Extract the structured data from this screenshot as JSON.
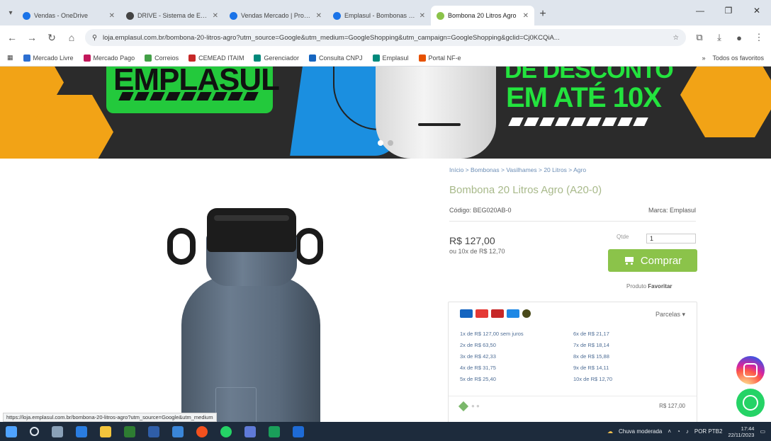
{
  "browser": {
    "tabs": [
      {
        "title": "Vendas - OneDrive",
        "color": "#1a73e8",
        "active": false
      },
      {
        "title": "DRIVE - Sistema de Emplasul",
        "color": "#444444",
        "active": false
      },
      {
        "title": "Vendas Mercado | Produtos",
        "color": "#1a73e8",
        "active": false
      },
      {
        "title": "Emplasul - Bombonas plas",
        "color": "#1a73e8",
        "active": false
      },
      {
        "title": "Bombona 20 Litros Agro",
        "color": "#8bc34a",
        "active": true
      }
    ],
    "new_tab": "+",
    "window_controls": [
      "—",
      "❐",
      "✕"
    ],
    "url": "loja.emplasul.com.br/bombona-20-litros-agro?utm_source=Google&utm_medium=GoogleShopping&utm_campaign=GoogleShopping&gclid=Cj0KCQiA...",
    "bookmarks": [
      {
        "label": "Mercado Livre",
        "color": "#2d6fd1"
      },
      {
        "label": "Mercado Pago",
        "color": "#c2185b"
      },
      {
        "label": "Correios",
        "color": "#43a047"
      },
      {
        "label": "CEMEAD ITAIM",
        "color": "#c62828"
      },
      {
        "label": "Gerenciador",
        "color": "#00897b"
      },
      {
        "label": "Consulta CNPJ",
        "color": "#1565c0"
      },
      {
        "label": "Emplasul",
        "color": "#00897b"
      },
      {
        "label": "Portal NF-e",
        "color": "#e65100"
      }
    ],
    "all_bookmarks": "Todos os favoritos"
  },
  "banner": {
    "brand": "EMPLASUL",
    "promo_line1": "DE DESCONTO",
    "promo_line2": "EM ATÉ 10X"
  },
  "product": {
    "breadcrumb": "Início > Bombonas > Vasilhames > 20 Litros > Agro",
    "title": "Bombona 20 Litros Agro (A20-0)",
    "code_label": "Código: BEG020AB-0",
    "brand_label": "Marca: Emplasul",
    "price": "R$ 127,00",
    "price_sub": "ou 10x de R$ 12,70",
    "qty_label": "Qtde",
    "qty_value": "1",
    "buy_label": "Comprar",
    "save_prefix": "Produto",
    "save_link": "Favoritar",
    "installments_label": "Parcelas ▾",
    "installments": [
      "1x de R$ 127,00 sem juros",
      "2x de R$ 63,50",
      "3x de R$ 42,33",
      "4x de R$ 31,75",
      "5x de R$ 25,40",
      "6x de R$ 21,17",
      "7x de R$ 18,14",
      "8x de R$ 15,88",
      "9x de R$ 14,11",
      "10x de R$ 12,70"
    ],
    "footer_price": "R$ 127,00"
  },
  "status_url": "https://loja.emplasul.com.br/bombona-20-litros-agro?utm_source=Google&utm_medium",
  "taskbar": {
    "weather": "Chuva moderada",
    "time": "17:44",
    "date": "22/11/2023",
    "lang": "POR PTB2"
  },
  "colors": {
    "accent_green": "#8bc34a",
    "banner_green": "#23e33e",
    "hex_orange": "#f2a316"
  }
}
